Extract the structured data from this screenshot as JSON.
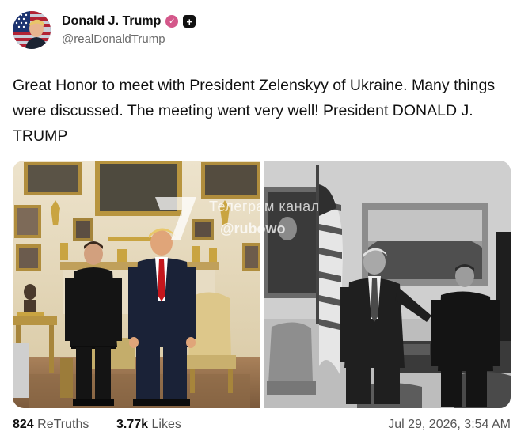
{
  "post": {
    "author_name": "Donald J. Trump",
    "handle": "@realDonaldTrump",
    "text": "Great Honor to meet with President Zelenskyy of Ukraine. Many things were discussed. The meeting went very well! President DONALD J. TRUMP",
    "watermark_line1": "Телеграм канал",
    "watermark_line2": "@rubowo"
  },
  "stats": {
    "retruths_count": "824",
    "retruths_label": "ReTruths",
    "likes_count": "3.77k",
    "likes_label": "Likes",
    "timestamp": "Jul 29, 2026, 3:54 AM"
  },
  "icons": {
    "verified": "verified-badge-icon",
    "plus": "plus-badge-icon"
  },
  "colors": {
    "verified_badge": "#d4578a",
    "text_primary": "#111111",
    "text_secondary": "#6b6b6b"
  }
}
